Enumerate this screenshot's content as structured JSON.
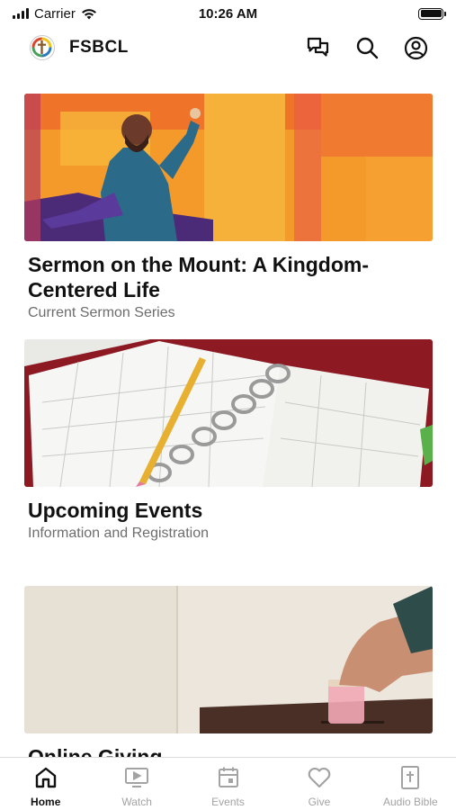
{
  "status_bar": {
    "carrier": "Carrier",
    "time": "10:26 AM"
  },
  "header": {
    "title": "FSBCL",
    "icons": [
      "chat-icon",
      "search-icon",
      "profile-icon"
    ]
  },
  "feed": {
    "cards": [
      {
        "title": "Sermon on the Mount: A Kingdom-Centered Life",
        "subtitle": "Current Sermon Series"
      },
      {
        "title": "Upcoming Events",
        "subtitle": "Information and Registration"
      },
      {
        "title": "Online Giving",
        "subtitle": ""
      }
    ]
  },
  "tab_bar": {
    "active": "Home",
    "active_color": "#111111",
    "inactive_color": "#a3a3a3",
    "tabs": [
      {
        "label": "Home",
        "icon": "home-icon"
      },
      {
        "label": "Watch",
        "icon": "tv-icon"
      },
      {
        "label": "Events",
        "icon": "calendar-icon"
      },
      {
        "label": "Give",
        "icon": "heart-icon"
      },
      {
        "label": "Audio Bible",
        "icon": "bible-icon"
      }
    ]
  }
}
